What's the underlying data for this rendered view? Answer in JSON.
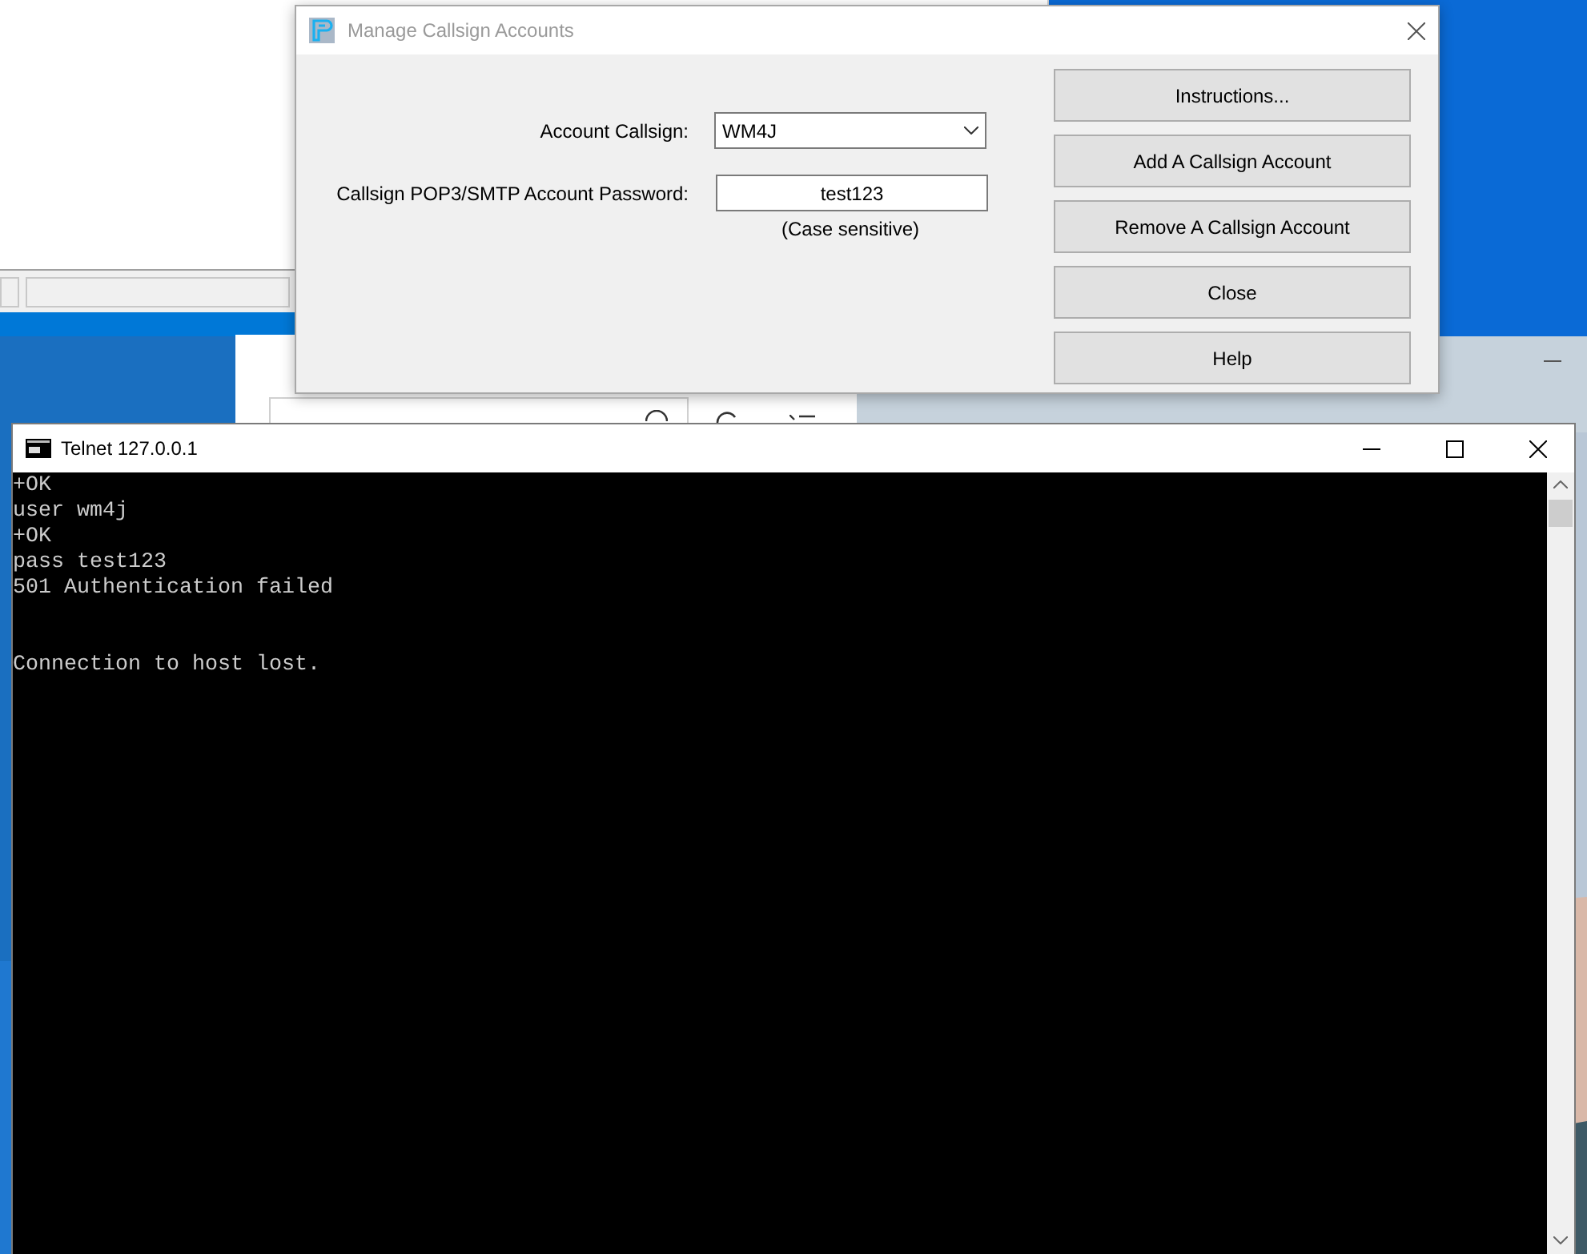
{
  "dialog": {
    "title": "Manage Callsign Accounts",
    "callsign": {
      "label": "Account Callsign:",
      "value": "WM4J"
    },
    "password": {
      "label": "Callsign POP3/SMTP Account Password:",
      "value": "test123",
      "hint": "(Case sensitive)"
    },
    "buttons": [
      "Instructions...",
      "Add A Callsign Account",
      "Remove A Callsign Account",
      "Close",
      "Help"
    ]
  },
  "telnet": {
    "title": "Telnet 127.0.0.1",
    "blocks": [
      {
        "lines": [
          "+OK",
          "user wm4j",
          "+OK",
          "pass test123",
          "501 Authentication failed"
        ]
      },
      {
        "lines": [
          "Connection to host lost."
        ]
      }
    ]
  }
}
